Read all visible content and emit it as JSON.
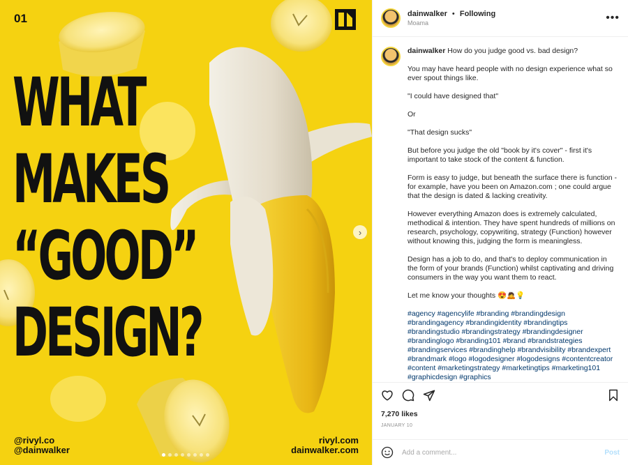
{
  "post_image": {
    "slide_number": "01",
    "headline_lines": [
      "WHAT",
      "MAKES",
      "“GOOD”",
      "DESIGN?"
    ],
    "handle_left_1": "@rivyl.co",
    "handle_left_2": "@dainwalker",
    "handle_right_1": "rivyl.com",
    "handle_right_2": "dainwalker.com",
    "background_color": "#f5d211",
    "carousel_total": 8,
    "carousel_active": 1
  },
  "header": {
    "username": "dainwalker",
    "separator": "•",
    "follow_status": "Following",
    "location": "Moama"
  },
  "caption": {
    "username": "dainwalker",
    "paragraphs": [
      "How do you judge good vs. bad design?",
      "You may have heard people with no design experience what so ever spout things like.",
      "\"I could have designed that\"",
      "Or",
      "\"That design sucks\"",
      "But before you judge the old \"book by it's cover\" - first it's important to take stock of the content & function.",
      "Form is easy to judge, but beneath the surface there is function - for example, have you been on Amazon.com ; one could argue that the design is dated & lacking creativity.",
      "However everything Amazon does is extremely calculated, methodical & intention. They have spent hundreds of millions on research, psychology, copywriting, strategy (Function) however without knowing this, judging the form is meaningless.",
      "Design has a job to do, and that's to deploy communication in the form of your brands (Function) whilst captivating and driving consumers in the way you want them to react.",
      "Let me know your thoughts 😍🙇💡"
    ],
    "hashtags": "#agency #agencylife #branding #brandingdesign #brandingagency #brandingidentity #brandingtips #brandingstudio #brandingstrategy #brandingdesigner #brandinglogo #branding101 #brand #brandstrategies #brandingservices #brandinghelp #brandvisibility #brandexpert #brandmark #logo #logodesigner #logodesigns #contentcreator #content #marketingstrategy #marketingtips #marketing101 #graphicdesign #graphics"
  },
  "stats": {
    "likes": "7,270 likes",
    "date": "JANUARY 10"
  },
  "comment": {
    "placeholder": "Add a comment...",
    "post_label": "Post"
  },
  "icons": {
    "like": "heart-icon",
    "comment": "comment-icon",
    "share": "share-icon",
    "save": "bookmark-icon",
    "emoji": "emoji-icon",
    "more": "more-options-icon",
    "next": "chevron-right-icon"
  }
}
